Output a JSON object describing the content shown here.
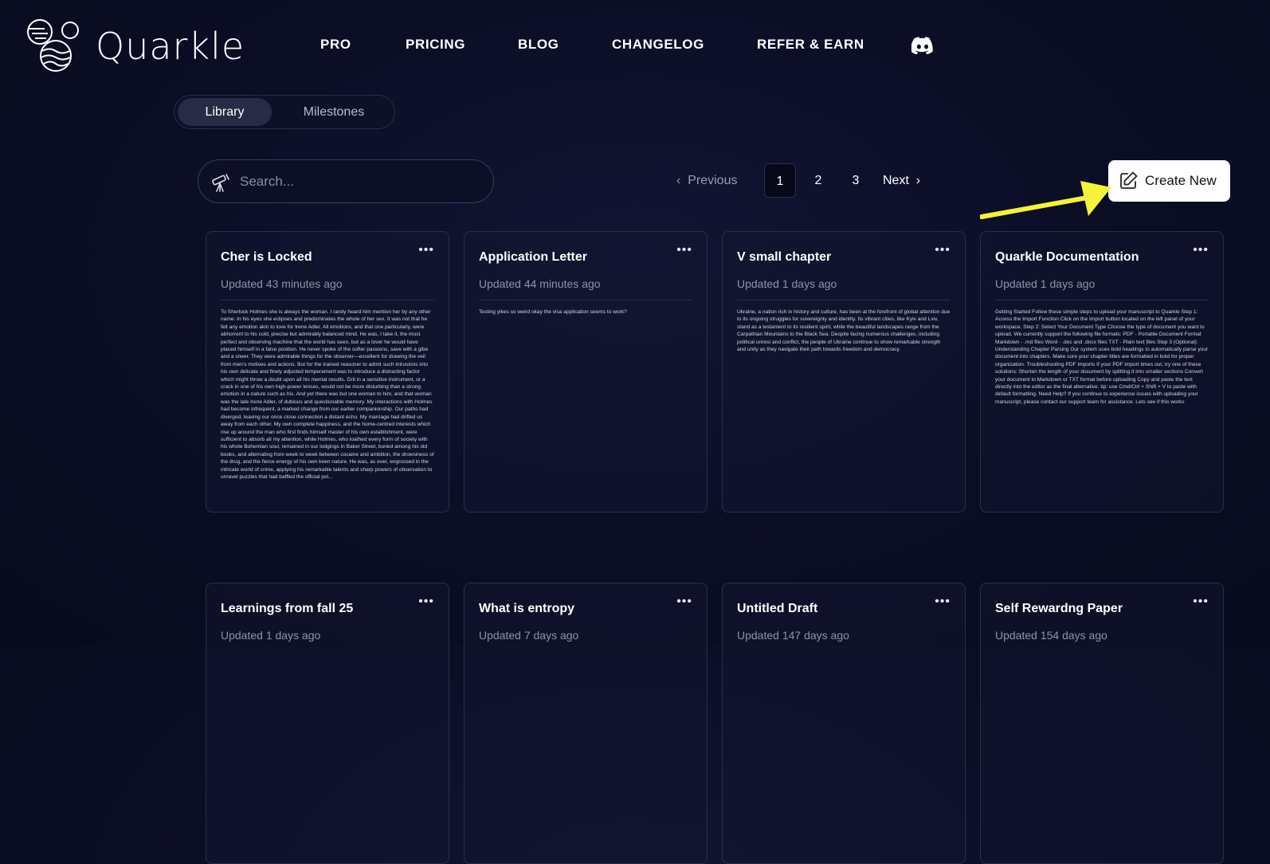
{
  "brand": {
    "name": "Quarkle"
  },
  "nav": {
    "items": [
      "PRO",
      "PRICING",
      "BLOG",
      "CHANGELOG",
      "REFER & EARN"
    ],
    "discord_icon": "discord-icon"
  },
  "tabs": {
    "active": "Library",
    "inactive": "Milestones"
  },
  "search": {
    "placeholder": "Search..."
  },
  "pagination": {
    "previous": "Previous",
    "pages": [
      "1",
      "2",
      "3"
    ],
    "current": "1",
    "next": "Next"
  },
  "create_button": {
    "label": "Create New"
  },
  "colors": {
    "background": "#0b0d24",
    "card_border": "#2b2f4c",
    "arrow": "#f4f23a"
  },
  "cards": [
    {
      "title": "Cher is Locked",
      "updated": "Updated 43 minutes ago",
      "preview": "To Sherlock Holmes she is always the woman. I rarely heard him mention her by any other name. In his eyes she eclipses and predominates the whole of her sex. It was not that he felt any emotion akin to love for Irene Adler. All emotions, and that one particularly, were abhorrent to his cold, precise but admirably balanced mind. He was, I take it, the most perfect and observing machine that the world has seen, but as a lover he would have placed himself in a false position. He never spoke of the softer passions, save with a gibe and a sneer. They were admirable things for the observer—excellent for drawing the veil from men's motives and actions. But for the trained reasoner to admit such intrusions into his own delicate and finely adjusted temperament was to introduce a distracting factor which might throw a doubt upon all his mental results. Grit in a sensitive instrument, or a crack in one of his own high-power lenses, would not be more disturbing than a strong emotion in a nature such as his. And yet there was but one woman to him, and that woman was the late Irene Adler, of dubious and questionable memory. My interactions with Holmes had become infrequent, a marked change from our earlier companionship. Our paths had diverged, leaving our once close connection a distant echo. My marriage had drifted us away from each other. My own complete happiness, and the home-centred interests which rise up around the man who first finds himself master of his own establishment, were sufficient to absorb all my attention, while Holmes, who loathed every form of society with his whole Bohemian soul, remained in our lodgings in Baker Street, buried among his old books, and alternating from week to week between cocaine and ambition, the drowsiness of the drug, and the fierce energy of his own keen nature. He was, as ever, engrossed in the intricate world of crime, applying his remarkable talents and sharp powers of observation to unravel puzzles that had baffled the official pol..."
    },
    {
      "title": "Application Letter",
      "updated": "Updated 44 minutes ago",
      "preview": "Testing yikes so weird okay the visa application seems to work?"
    },
    {
      "title": "V small chapter",
      "updated": "Updated 1 days ago",
      "preview": "Ukraine, a nation rich in history and culture, has been at the forefront of global attention due to its ongoing struggles for sovereignty and identity. Its vibrant cities, like Kyiv and Lviv, stand as a testament to its resilient spirit, while the beautiful landscapes range from the Carpathian Mountains to the Black Sea. Despite facing numerous challenges, including political unrest and conflict, the people of Ukraine continue to show remarkable strength and unity as they navigate their path towards freedom and democracy."
    },
    {
      "title": "Quarkle Documentation",
      "updated": "Updated 1 days ago",
      "preview": "Getting Started Follow these simple steps to upload your manuscript to Quarkle Step 1: Access the Import Function Click on the Import button located on the left panel of your workspace. Step 2: Select Your Document Type Choose the type of document you want to upload. We currently support the following file formats: PDF - Portable Document Format Markdown - .md files Word - .doc and .docx files TXT - Plain text files Step 3 (Optional): Understanding Chapter Parsing Our system uses bold headings to automatically parse your document into chapters. Make sure your chapter titles are formatted in bold for proper organization. Troubleshooting PDF Imports If your PDF import times out, try one of these solutions: Shorten the length of your document by splitting it into smaller sections Convert your document to Markdown or TXT format before uploading Copy and paste the text directly into the editor as the final alternative. tip: use Cmd/Ctrl + Shift + V to paste with default formatting. Need Help? If you continue to experience issues with uploading your manuscript, please contact our support team for assistance. Lets see if this works"
    },
    {
      "title": "Learnings from fall 25",
      "updated": "Updated 1 days ago",
      "preview": ""
    },
    {
      "title": "What is entropy",
      "updated": "Updated 7 days ago",
      "preview": ""
    },
    {
      "title": "Untitled Draft",
      "updated": "Updated 147 days ago",
      "preview": ""
    },
    {
      "title": "Self Rewardng Paper",
      "updated": "Updated 154 days ago",
      "preview": ""
    }
  ]
}
